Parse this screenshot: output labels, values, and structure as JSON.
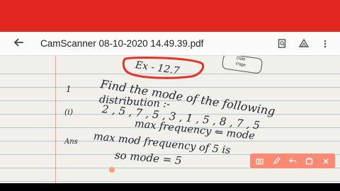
{
  "app": {
    "title": "CamScanner 08-10-2020 14.49.39.pdf",
    "back_icon": "arrow-left-icon",
    "actions": [
      {
        "name": "search-document-icon"
      },
      {
        "name": "drive-icon"
      },
      {
        "name": "more-vertical-icon"
      }
    ]
  },
  "note": {
    "header": "Ex - 12.7",
    "stamp": {
      "date": "Date",
      "page": "Page"
    },
    "lines": [
      {
        "label": "1",
        "text": "Find the mode of the following"
      },
      {
        "label": "",
        "text": "distribution :-"
      },
      {
        "label": "(i)",
        "text": "2 , 5 , 7 , 5 , 3 , 1 , 5 , 8 , 7 , 5"
      },
      {
        "label": "",
        "text": "max frequency ⇐ mode"
      },
      {
        "label": "Ans",
        "text": "max mod frequency of 5 is"
      },
      {
        "label": "",
        "text": "so mode = 5"
      }
    ]
  },
  "toolbar": {
    "buttons": [
      "screenshot-icon",
      "draw-icon",
      "undo-icon",
      "share-icon",
      "close-icon"
    ],
    "accent": "#ff8a73"
  },
  "colors": {
    "statusbar": "#e1271f",
    "paper": "#f2f0ea",
    "highlight": "#e3342a"
  }
}
